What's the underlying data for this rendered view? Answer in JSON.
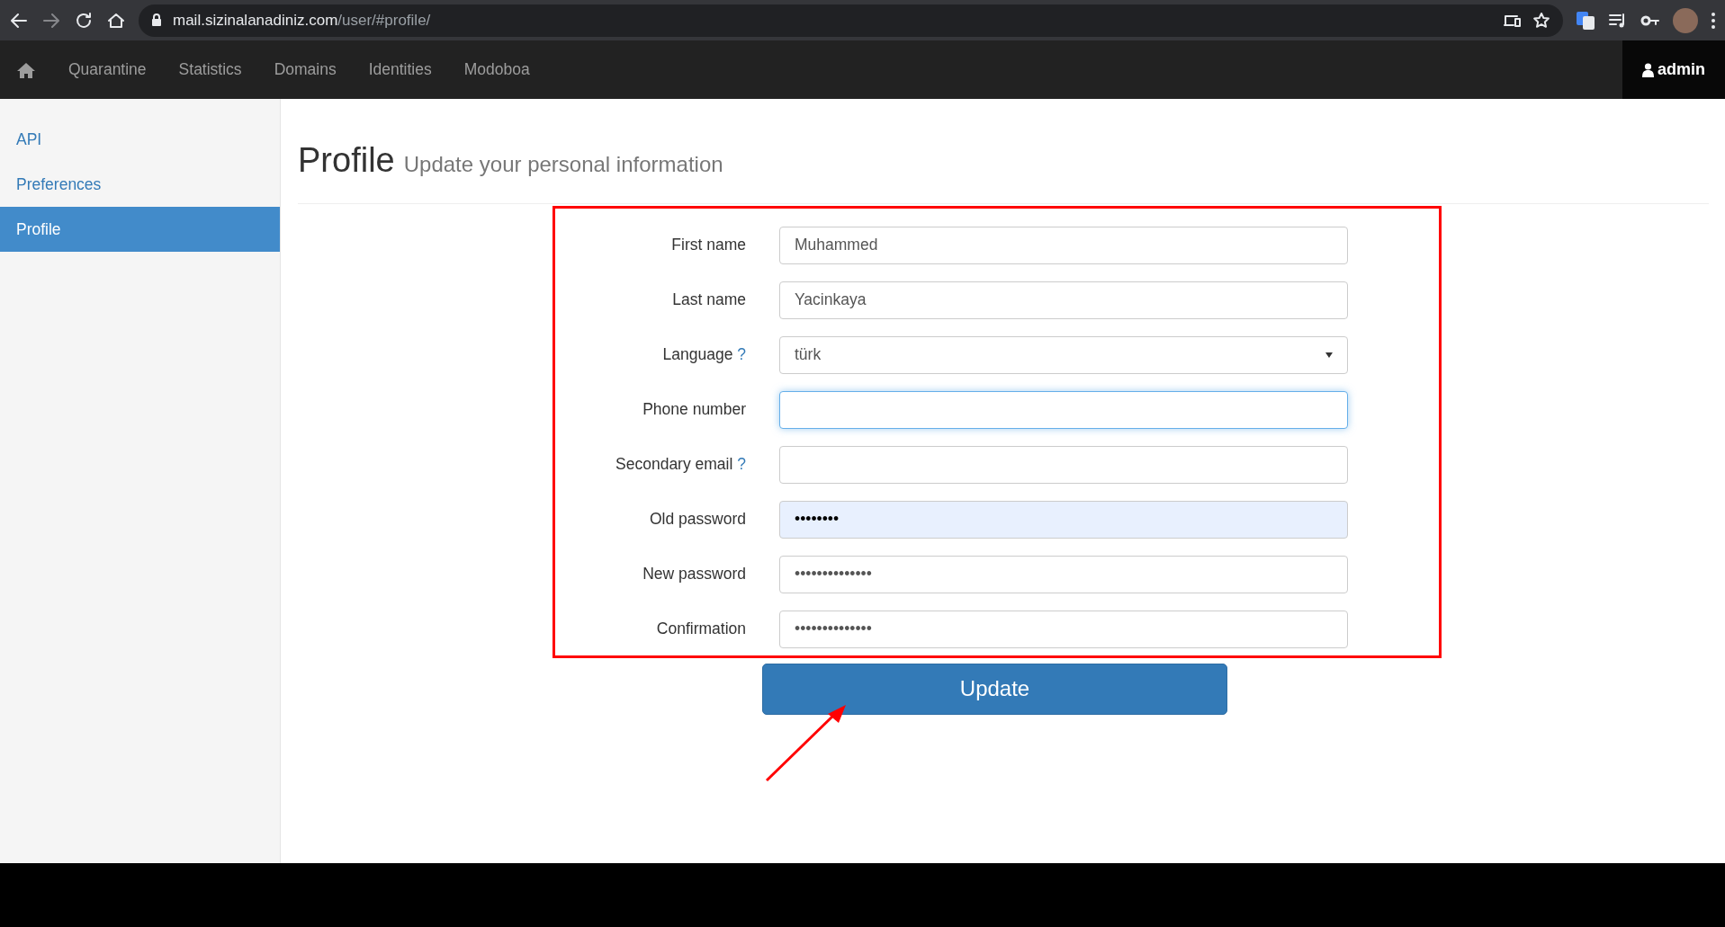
{
  "browser": {
    "url_host": "mail.sizinalanadiniz.com",
    "url_path": "/user/#profile/",
    "forward_disabled": true
  },
  "navbar": {
    "items": [
      {
        "label": "Quarantine"
      },
      {
        "label": "Statistics"
      },
      {
        "label": "Domains"
      },
      {
        "label": "Identities"
      },
      {
        "label": "Modoboa"
      }
    ],
    "user": "admin"
  },
  "sidebar": {
    "items": [
      {
        "label": "API",
        "selected": false
      },
      {
        "label": "Preferences",
        "selected": false
      },
      {
        "label": "Profile",
        "selected": true
      }
    ]
  },
  "page": {
    "title": "Profile",
    "subtitle": "Update your personal information"
  },
  "form": {
    "fields": [
      {
        "label": "First name",
        "kind": "text",
        "value": "Muhammed",
        "focused": false,
        "autofilled": false
      },
      {
        "label": "Last name",
        "kind": "text",
        "value": "Yacinkaya",
        "focused": false,
        "autofilled": false
      },
      {
        "label": "Language",
        "kind": "select",
        "value": "türk",
        "help_mark": "?",
        "focused": false,
        "autofilled": false
      },
      {
        "label": "Phone number",
        "kind": "text",
        "focused": true,
        "autofilled": false
      },
      {
        "label": "Secondary email",
        "kind": "text",
        "help_mark": "?",
        "focused": false,
        "autofilled": false
      },
      {
        "label": "Old password",
        "kind": "password",
        "value": "••••••••",
        "focused": false,
        "autofilled": true
      },
      {
        "label": "New password",
        "kind": "password",
        "value": "••••••••••••••",
        "focused": false,
        "autofilled": false
      },
      {
        "label": "Confirmation",
        "kind": "password",
        "value": "••••••••••••••",
        "focused": false,
        "autofilled": false
      }
    ],
    "submit": "Update"
  }
}
